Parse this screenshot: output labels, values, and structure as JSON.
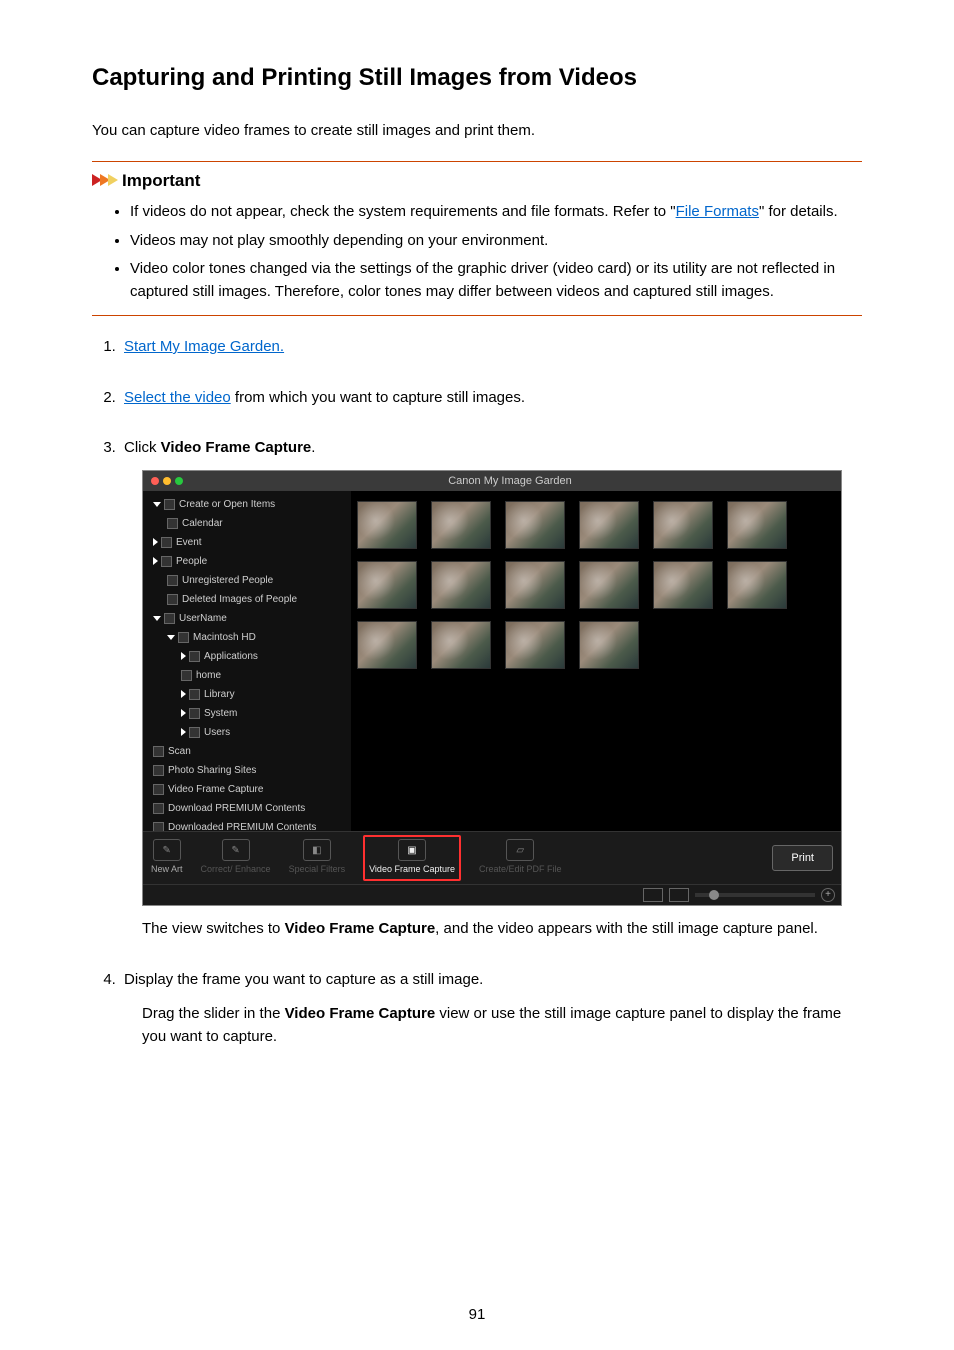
{
  "heading": "Capturing and Printing Still Images from Videos",
  "intro": "You can capture video frames to create still images and print them.",
  "callout": {
    "title": "Important",
    "items": [
      {
        "pre": "If videos do not appear, check the system requirements and file formats. Refer to \"",
        "link": "File Formats",
        "post": "\" for details."
      },
      {
        "text": "Videos may not play smoothly depending on your environment."
      },
      {
        "text": "Video color tones changed via the settings of the graphic driver (video card) or its utility are not reflected in captured still images. Therefore, color tones may differ between videos and captured still images."
      }
    ]
  },
  "steps": {
    "s1_link": "Start My Image Garden.",
    "s2_link": "Select the video",
    "s2_rest": " from which you want to capture still images.",
    "s3_pre": "Click ",
    "s3_bold": "Video Frame Capture",
    "s3_post": ".",
    "s3_after_pre": "The view switches to ",
    "s3_after_bold": "Video Frame Capture",
    "s3_after_post": ", and the video appears with the still image capture panel.",
    "s4_text": "Display the frame you want to capture as a still image.",
    "s4_body_pre": "Drag the slider in the ",
    "s4_body_bold": "Video Frame Capture",
    "s4_body_post": " view or use the still image capture panel to display the frame you want to capture."
  },
  "screenshot": {
    "window_title": "Canon My Image Garden",
    "sidebar": {
      "items": [
        "Create or Open Items",
        "Calendar",
        "Event",
        "People",
        "Unregistered People",
        "Deleted Images of People",
        "UserName",
        "Macintosh HD",
        "Applications",
        "home",
        "Library",
        "System",
        "Users",
        "Scan",
        "Photo Sharing Sites",
        "Video Frame Capture",
        "Download PREMIUM Contents",
        "Downloaded PREMIUM Contents"
      ]
    },
    "toolbar": {
      "new_art": "New Art",
      "correct": "Correct/\nEnhance",
      "filters": "Special\nFilters",
      "vfc": "Video Frame\nCapture",
      "pdf": "Create/Edit\nPDF File",
      "print": "Print"
    }
  },
  "page_number": "91"
}
